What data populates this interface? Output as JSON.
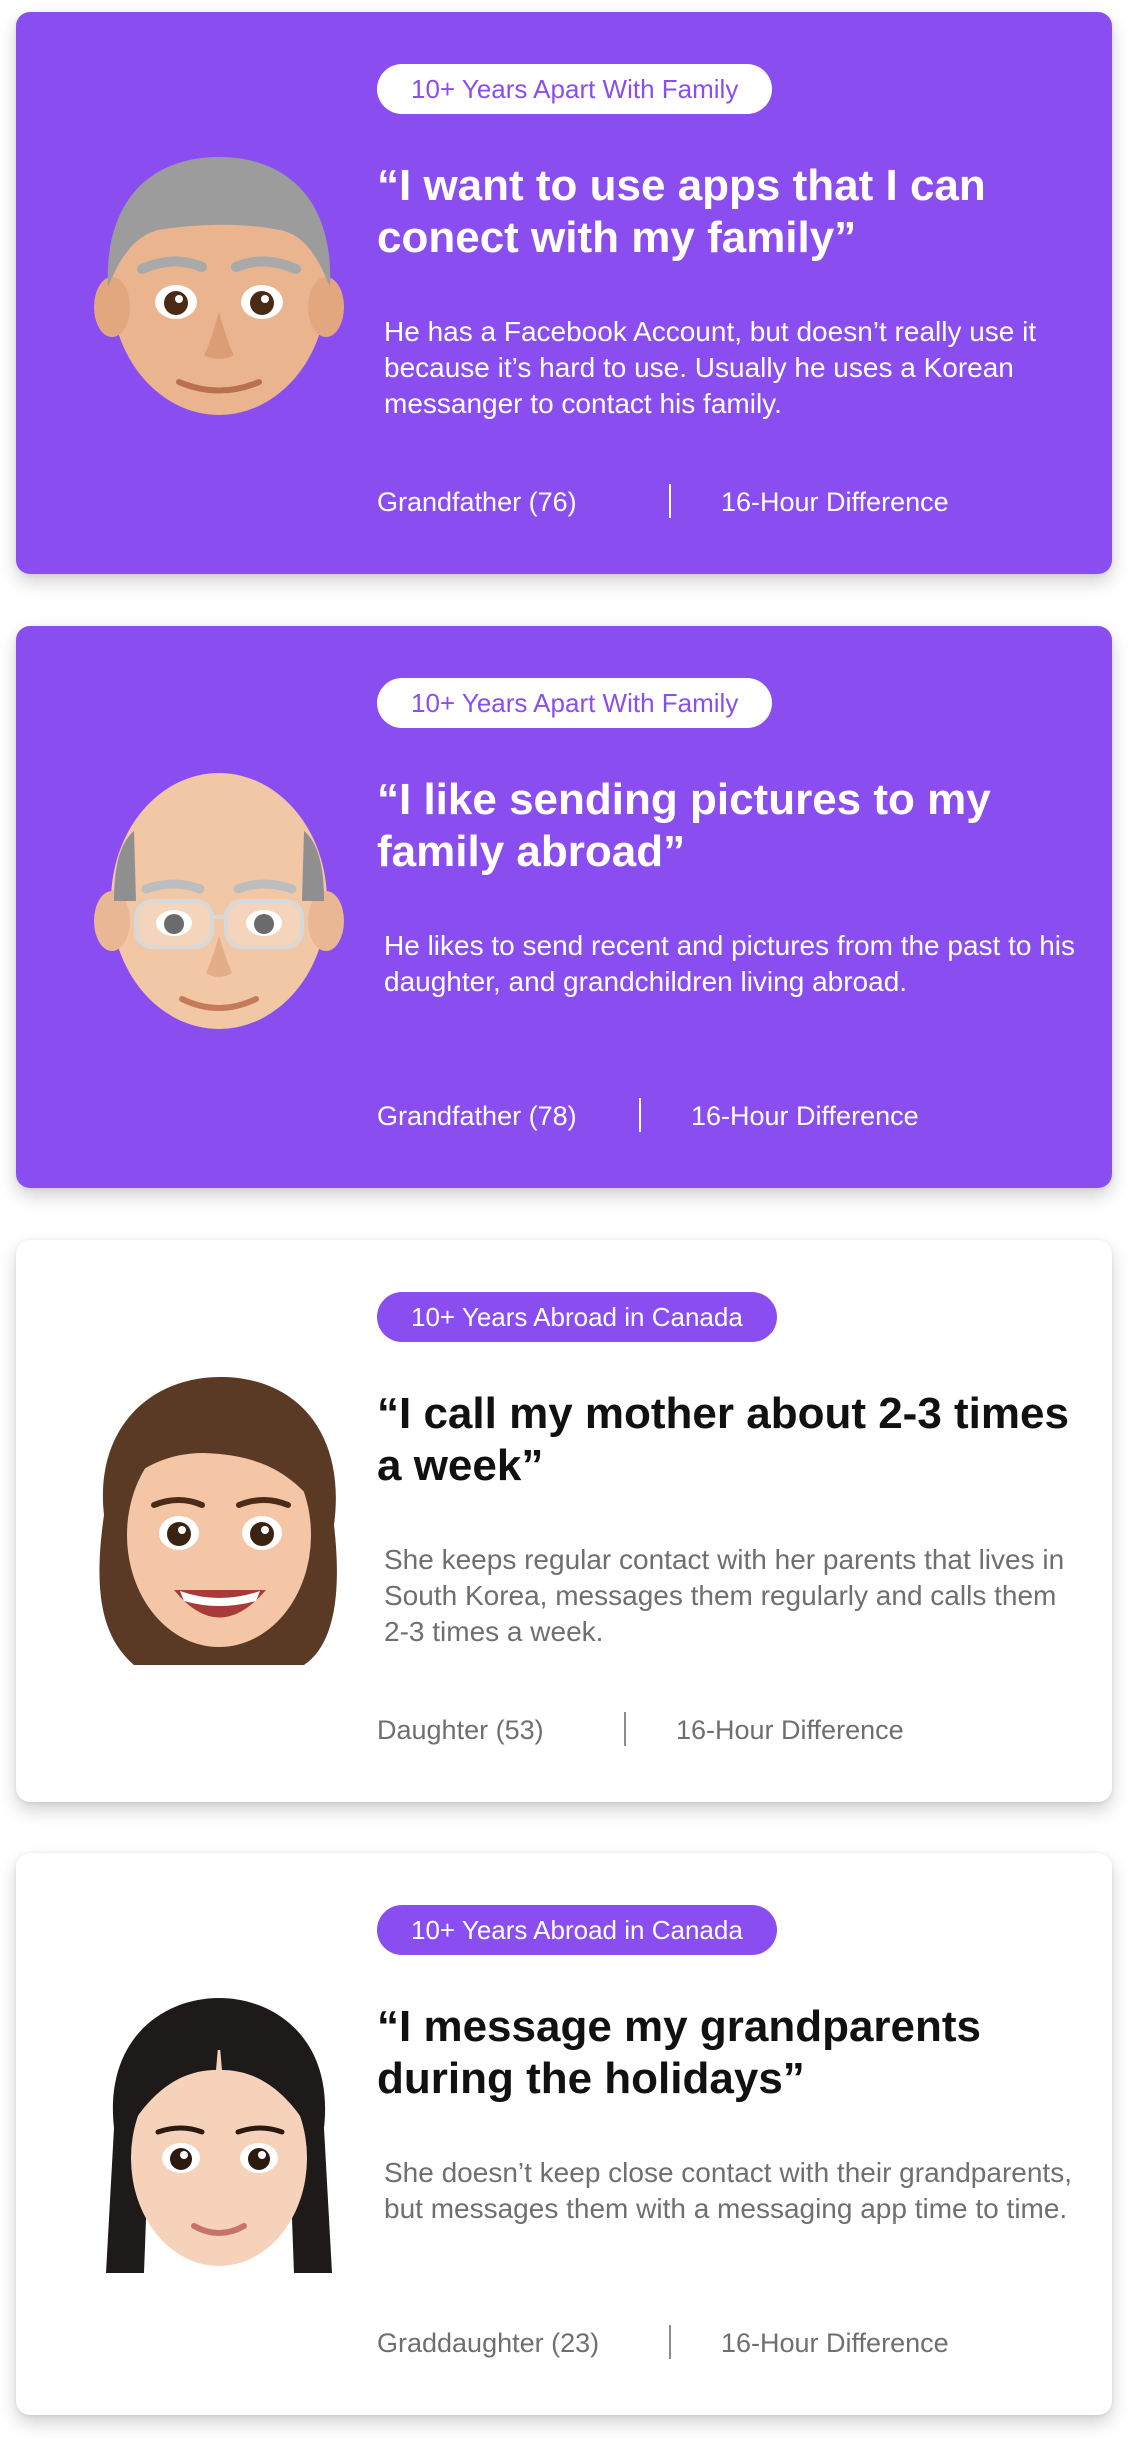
{
  "colors": {
    "accent": "#8a4ef0",
    "white": "#ffffff",
    "dark_text": "#111111",
    "muted_text": "#6f6f6f"
  },
  "personas": [
    {
      "style": "purple",
      "avatar_icon": "grandfather-memoji-icon",
      "tag": "10+ Years Apart With Family",
      "quote": "“I want to use apps that I can conect with my family”",
      "description": "He has a Facebook Account, but doesn’t really use it because it’s hard to use. Usually he uses a Korean messanger to contact his family.",
      "role": "Grandfather (76)",
      "time_difference": "16-Hour Difference"
    },
    {
      "style": "purple",
      "avatar_icon": "bald-grandfather-memoji-icon",
      "tag": "10+ Years Apart With Family",
      "quote": "“I like sending pictures to my family abroad”",
      "description": "He likes to send recent and pictures from the past to his daughter, and grandchildren living abroad.",
      "role": "Grandfather (78)",
      "time_difference": "16-Hour Difference"
    },
    {
      "style": "white",
      "avatar_icon": "daughter-memoji-icon",
      "tag": "10+ Years Abroad in Canada",
      "quote": "“I call my mother about 2-3 times a week”",
      "description": "She keeps regular contact with her parents that lives in South Korea, messages them regularly and calls them 2-3 times a week.",
      "role": "Daughter (53)",
      "time_difference": "16-Hour Difference"
    },
    {
      "style": "white",
      "avatar_icon": "granddaughter-memoji-icon",
      "tag": "10+ Years Abroad in Canada",
      "quote": "“I message my grandparents during the holidays”",
      "description": "She doesn’t keep close contact with their grandparents, but messages them with a messaging app time to time.",
      "role": "Graddaughter (23)",
      "time_difference": "16-Hour Difference"
    }
  ]
}
